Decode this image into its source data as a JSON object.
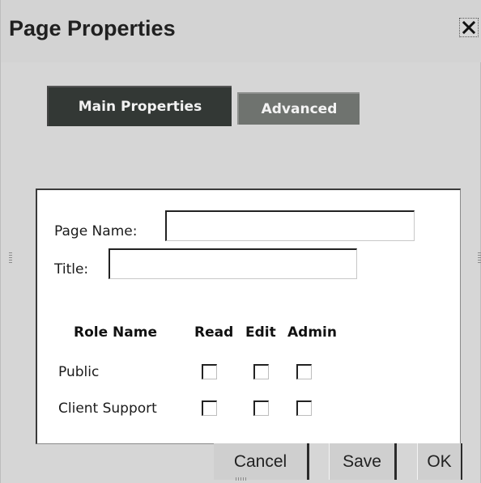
{
  "window": {
    "title": "Page Properties",
    "close_icon": "close-icon"
  },
  "tabs": [
    {
      "label": "Main Properties",
      "active": true
    },
    {
      "label": "Advanced",
      "active": false
    }
  ],
  "form": {
    "page_name_label": "Page Name:",
    "page_name_value": "",
    "title_label": "Title:",
    "title_value": ""
  },
  "permissions": {
    "headers": [
      "Role Name",
      "Read",
      "Edit",
      "Admin"
    ],
    "rows": [
      {
        "role": "Public",
        "read": false,
        "edit": false,
        "admin": false
      },
      {
        "role": "Client Support",
        "read": false,
        "edit": false,
        "admin": false
      }
    ]
  },
  "buttons": {
    "cancel": "Cancel",
    "save": "Save",
    "ok": "OK"
  },
  "colors": {
    "active_tab": "#333835",
    "inactive_tab": "#6f736f",
    "dialog_bg": "#d6d6d6"
  }
}
